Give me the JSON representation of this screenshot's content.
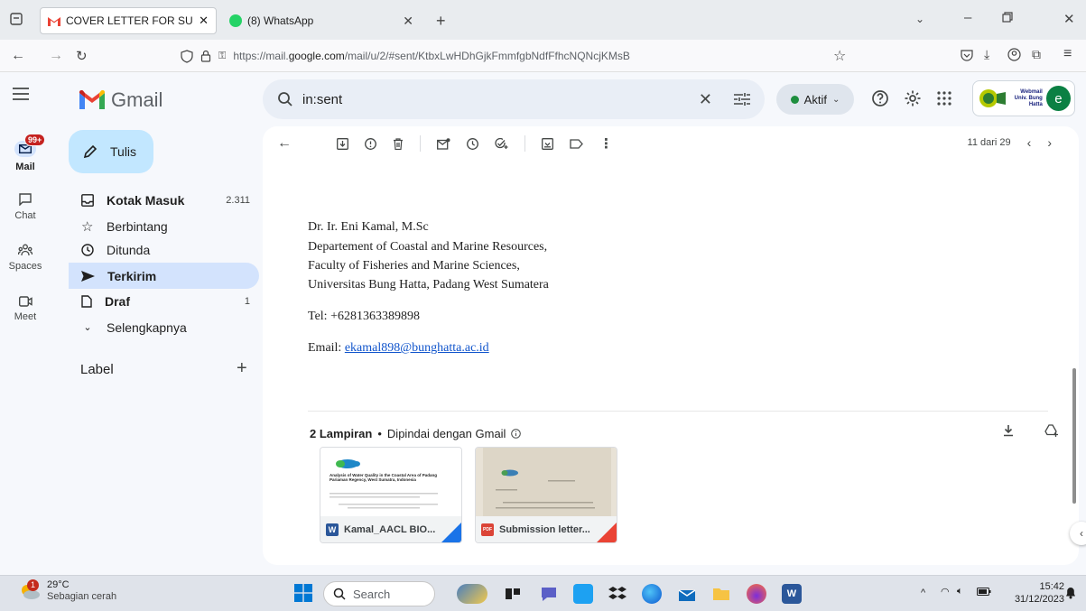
{
  "browser": {
    "tabs": [
      {
        "title": "COVER LETTER FOR SUBMISSIO",
        "active": true
      },
      {
        "title": "(8) WhatsApp",
        "active": false
      }
    ],
    "url_prefix": "https://mail.",
    "url_host": "google.com",
    "url_path": "/mail/u/2/#sent/KtbxLwHDhGjkFmmfgbNdfFfhcNQNcjKMsB"
  },
  "gmail": {
    "logo_text": "Gmail",
    "search_value": "in:sent",
    "status": "Aktif",
    "webmail_text": "Webmail Univ. Bung Hatta",
    "avatar_letter": "e"
  },
  "rail": {
    "mail_badge": "99+",
    "items": [
      "Mail",
      "Chat",
      "Spaces",
      "Meet"
    ]
  },
  "nav": {
    "compose": "Tulis",
    "items": [
      {
        "label": "Kotak Masuk",
        "count": "2.311"
      },
      {
        "label": "Berbintang",
        "count": ""
      },
      {
        "label": "Ditunda",
        "count": ""
      },
      {
        "label": "Terkirim",
        "count": ""
      },
      {
        "label": "Draf",
        "count": "1"
      },
      {
        "label": "Selengkapnya",
        "count": ""
      }
    ],
    "label_header": "Label"
  },
  "toolbar": {
    "pager": "11 dari 29"
  },
  "signature": {
    "name": "Dr. Ir. Eni Kamal, M.Sc",
    "dept": "Departement of Coastal and Marine Resources,",
    "faculty": "Faculty of Fisheries and Marine Sciences,",
    "university": "Universitas Bung Hatta, Padang West Sumatera",
    "tel": "Tel: +6281363389898",
    "email_label": "Email: ",
    "email": "ekamal898@bunghatta.ac.id"
  },
  "attachments": {
    "count_label": "2 Lampiran",
    "scan_note": "Dipindai dengan Gmail",
    "files": [
      {
        "name": "Kamal_AACL BIO...",
        "type": "W",
        "preview_title": "Analysis of Water Quality in the Coastal Area of Padang Pariaman Regency, West Sumatra, Indonesia"
      },
      {
        "name": "Submission letter...",
        "type": "PDF"
      }
    ]
  },
  "taskbar": {
    "notif_badge": "1",
    "temperature": "29°C",
    "weather": "Sebagian cerah",
    "search": "Search",
    "time": "15:42",
    "date": "31/12/2023"
  },
  "colors": {
    "compose_bg": "#c2e7ff",
    "selected_nav": "#d3e3fd",
    "badge_red": "#c5221f",
    "status_green": "#1e8e3e"
  }
}
